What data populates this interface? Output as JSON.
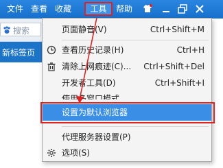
{
  "menubar": {
    "items": [
      {
        "label": "文件"
      },
      {
        "label": "查看"
      },
      {
        "label": "收藏"
      },
      {
        "label": "工具"
      },
      {
        "label": "帮助"
      }
    ]
  },
  "window_controls": [
    "shirt-icon",
    "minimize-icon",
    "restore-icon",
    "close-icon"
  ],
  "search": {
    "placeholder": "搜索"
  },
  "tab": {
    "label": "新标签页"
  },
  "tools_menu": {
    "items": [
      {
        "label": "页面静音(V)",
        "shortcut": "Ctrl+Shift+M",
        "icon": ""
      },
      {
        "label": "查看历史记录(H)",
        "shortcut": "Ctrl+H",
        "icon": "clock-icon"
      },
      {
        "label": "清除上网痕迹(C)...",
        "shortcut": "Ctrl+Shift+Del",
        "icon": "trash-icon"
      },
      {
        "label": "开发者工具(D)",
        "shortcut": "Ctrl+Shift+I",
        "icon": ""
      },
      {
        "label": "使用多窗口模式",
        "shortcut": "",
        "icon": ""
      },
      {
        "label": "设置为默认浏览器",
        "shortcut": "",
        "icon": ""
      },
      {
        "label": "代理服务器设置(P)",
        "shortcut": "",
        "icon": ""
      },
      {
        "label": "选项(S)",
        "shortcut": "",
        "icon": "gear-icon"
      }
    ]
  },
  "colors": {
    "titlebar": "#1779d6",
    "highlight": "#3a8ee6",
    "annotation": "#e02222"
  }
}
